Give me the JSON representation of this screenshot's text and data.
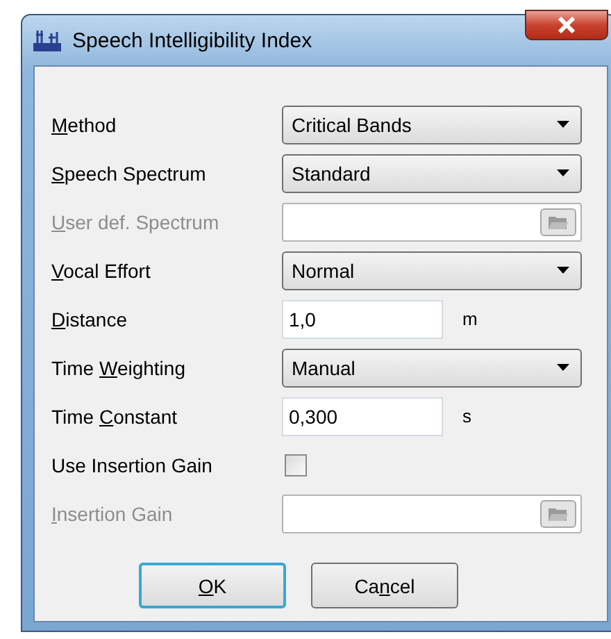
{
  "window": {
    "title": "Speech Intelligibility Index"
  },
  "rows": [
    {
      "kind": "dropdown",
      "label": {
        "key": "M",
        "after": "ethod"
      },
      "disabled": false,
      "value": "Critical Bands"
    },
    {
      "kind": "dropdown",
      "label": {
        "key": "S",
        "after": "peech Spectrum"
      },
      "disabled": false,
      "value": "Standard"
    },
    {
      "kind": "file",
      "label": {
        "key": "U",
        "after": "ser def. Spectrum"
      },
      "disabled": true
    },
    {
      "kind": "dropdown",
      "label": {
        "key": "V",
        "after": "ocal Effort"
      },
      "disabled": false,
      "value": "Normal"
    },
    {
      "kind": "number",
      "label": {
        "key": "D",
        "after": "istance"
      },
      "disabled": false,
      "value": "1,0",
      "unit": "m"
    },
    {
      "kind": "dropdown",
      "label": {
        "before": "Time ",
        "key": "W",
        "after": "eighting"
      },
      "disabled": false,
      "value": "Manual"
    },
    {
      "kind": "number",
      "label": {
        "before": "Time ",
        "key": "C",
        "after": "onstant"
      },
      "disabled": false,
      "value": "0,300",
      "unit": "s"
    },
    {
      "kind": "checkbox",
      "label": {
        "before": "Use Insertion Gain"
      },
      "disabled": false,
      "checked": false
    },
    {
      "kind": "file",
      "label": {
        "key": "I",
        "after": "nsertion Gain"
      },
      "disabled": true
    }
  ],
  "buttons": [
    {
      "label": {
        "key": "O",
        "after": "K"
      },
      "default": true
    },
    {
      "label": {
        "before": "Ca",
        "key": "n",
        "after": "cel"
      },
      "default": false
    }
  ]
}
